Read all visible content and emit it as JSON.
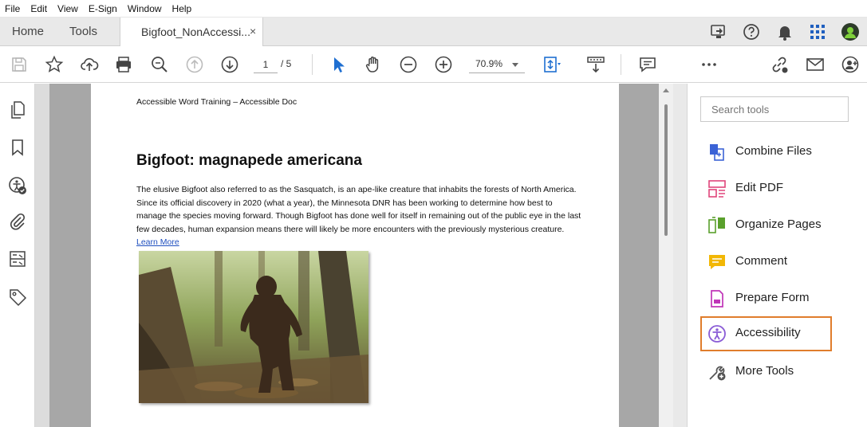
{
  "menu": [
    "File",
    "Edit",
    "View",
    "E-Sign",
    "Window",
    "Help"
  ],
  "tabs": {
    "home": "Home",
    "tools": "Tools",
    "document": "Bigfoot_NonAccessi...",
    "close_glyph": "×"
  },
  "toolbar": {
    "page_current": "1",
    "page_total": "/ 5",
    "zoom": "70.9%"
  },
  "document": {
    "header": "Accessible Word Training – Accessible Doc",
    "title": "Bigfoot: magnapede americana",
    "body": "The elusive Bigfoot also referred to as the Sasquatch, is an ape-like creature that inhabits the forests of North America. Since its official discovery in 2020 (what a year), the Minnesota DNR has been working to determine how best to manage the species moving forward. Though Bigfoot has done well for itself in remaining out of the public eye in the last few decades, human expansion means there will likely be more encounters with the previously mysterious creature.",
    "link": "Learn More"
  },
  "tools_panel": {
    "search_placeholder": "Search tools",
    "items": [
      {
        "label": "Combine Files",
        "icon": "combine-files-icon",
        "color": "#3b63d6"
      },
      {
        "label": "Edit PDF",
        "icon": "edit-pdf-icon",
        "color": "#e0457b"
      },
      {
        "label": "Organize Pages",
        "icon": "organize-pages-icon",
        "color": "#5aa02c"
      },
      {
        "label": "Comment",
        "icon": "comment-icon",
        "color": "#f2b705"
      },
      {
        "label": "Prepare Form",
        "icon": "prepare-form-icon",
        "color": "#c035b8"
      },
      {
        "label": "Accessibility",
        "icon": "accessibility-icon",
        "color": "#8a5cd6"
      },
      {
        "label": "More Tools",
        "icon": "more-tools-icon",
        "color": "#555555"
      }
    ],
    "highlight_color": "#e07d2c"
  },
  "colors": {
    "select_tool_blue": "#1f6fd1",
    "gutter": "#a7a7a7"
  }
}
